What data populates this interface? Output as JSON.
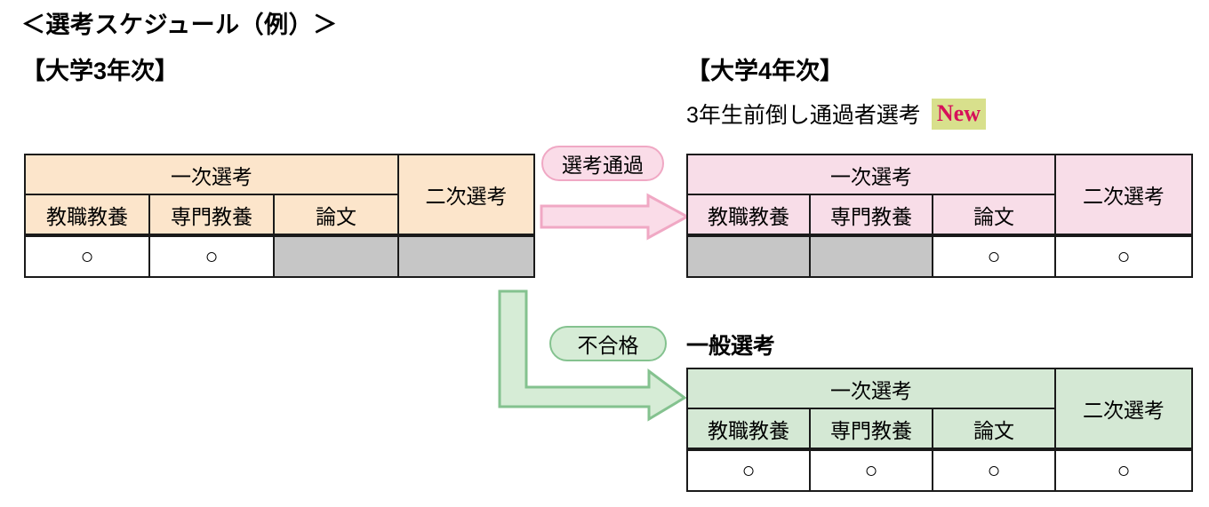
{
  "title": "＜選考スケジュール（例）＞",
  "sections": {
    "year3": {
      "heading": "【大学3年次】"
    },
    "year4": {
      "heading": "【大学4年次】",
      "fast_track_label": "3年生前倒し通過者選考",
      "new_badge": "New",
      "general_label": "一般選考"
    }
  },
  "callouts": {
    "pass": "選考通過",
    "fail": "不合格"
  },
  "table_common": {
    "primary_header": "一次選考",
    "secondary_header": "二次選考",
    "subcolumns": [
      "教職教養",
      "専門教養",
      "論文"
    ],
    "mark": "○",
    "blank": ""
  },
  "tables": [
    {
      "id": "year3-selection",
      "header_color": "#fce5cb",
      "primary_header": "一次選考",
      "secondary_header": "二次選考",
      "subcolumns": [
        "教職教養",
        "専門教養",
        "論文"
      ],
      "row": [
        {
          "value": "○",
          "state": "marked"
        },
        {
          "value": "○",
          "state": "marked"
        },
        {
          "value": "",
          "state": "disabled"
        },
        {
          "value": "",
          "state": "disabled"
        }
      ]
    },
    {
      "id": "fast-track-selection",
      "header_color": "#f8dde8",
      "primary_header": "一次選考",
      "secondary_header": "二次選考",
      "subcolumns": [
        "教職教養",
        "専門教養",
        "論文"
      ],
      "row": [
        {
          "value": "",
          "state": "disabled"
        },
        {
          "value": "",
          "state": "disabled"
        },
        {
          "value": "○",
          "state": "marked"
        },
        {
          "value": "○",
          "state": "marked"
        }
      ]
    },
    {
      "id": "general-selection",
      "header_color": "#d4e8d4",
      "primary_header": "一次選考",
      "secondary_header": "二次選考",
      "subcolumns": [
        "教職教養",
        "専門教養",
        "論文"
      ],
      "row": [
        {
          "value": "○",
          "state": "marked"
        },
        {
          "value": "○",
          "state": "marked"
        },
        {
          "value": "○",
          "state": "marked"
        },
        {
          "value": "○",
          "state": "marked"
        }
      ]
    }
  ],
  "colors": {
    "peach_header": "#fce5cb",
    "pink_header": "#f8dde8",
    "green_header": "#d4e8d4",
    "disabled_cell": "#c6c6c6",
    "pink_arrow_fill": "#fadce8",
    "pink_arrow_stroke": "#f0a8c4",
    "green_arrow_fill": "#d6ecd6",
    "green_arrow_stroke": "#84c28f",
    "new_badge_bg": "#d8e08c",
    "new_badge_text": "#d6105a",
    "border": "#1a1a1a"
  }
}
